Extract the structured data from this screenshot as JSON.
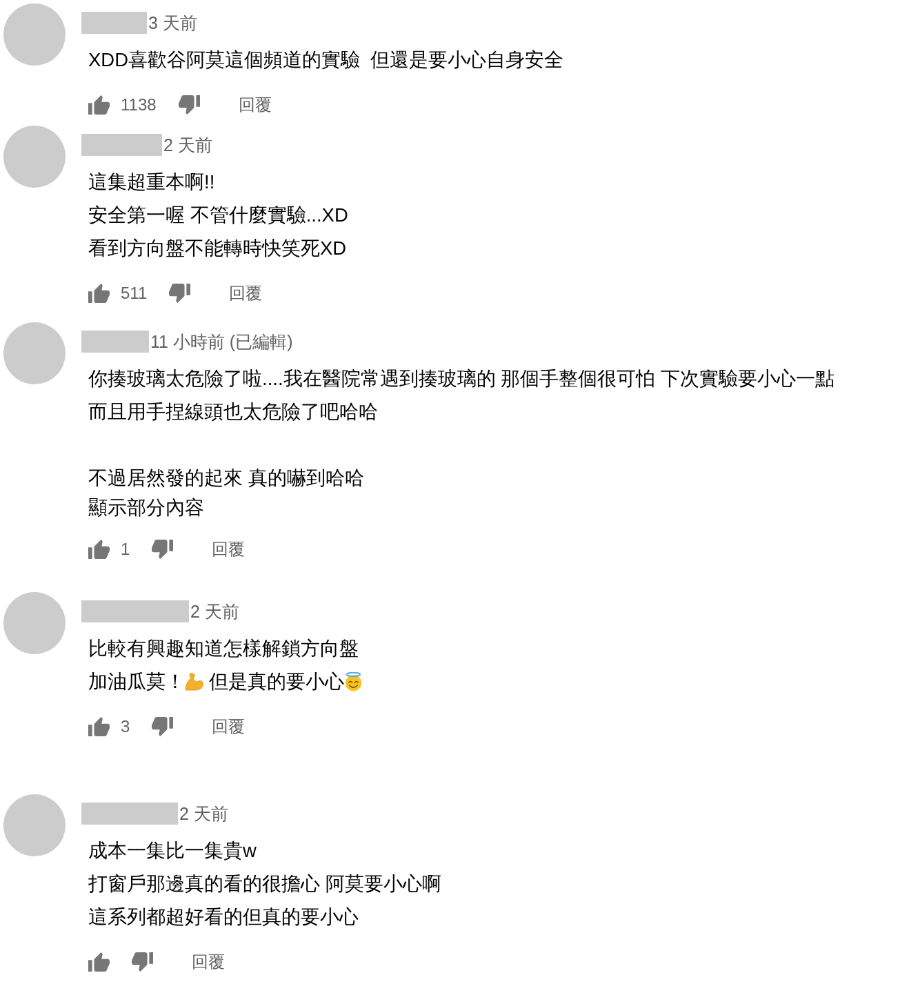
{
  "comments": [
    {
      "time": "3 天前",
      "paragraphs": [
        [
          [
            {
              "kind": "text",
              "text": "XDD喜歡谷阿莫這個頻道的實驗  但還是要小心自身安全"
            }
          ]
        ]
      ],
      "like_count": "1138",
      "reply": "回覆"
    },
    {
      "time": "2 天前",
      "paragraphs": [
        [
          [
            {
              "kind": "text",
              "text": "這集超重本啊!!"
            }
          ],
          [
            {
              "kind": "text",
              "text": "安全第一喔 不管什麼實驗...XD"
            }
          ],
          [
            {
              "kind": "text",
              "text": "看到方向盤不能轉時快笑死XD"
            }
          ]
        ]
      ],
      "like_count": "511",
      "reply": "回覆"
    },
    {
      "time": "11 小時前 (已編輯)",
      "paragraphs": [
        [
          [
            {
              "kind": "text",
              "text": "你揍玻璃太危險了啦....我在醫院常遇到揍玻璃的 那個手整個很可怕 下次實驗要小心一點"
            }
          ],
          [
            {
              "kind": "text",
              "text": "而且用手捏線頭也太危險了吧哈哈"
            }
          ]
        ],
        [
          [
            {
              "kind": "text",
              "text": "不過居然發的起來 真的嚇到哈哈"
            }
          ]
        ]
      ],
      "show_less": "顯示部分內容",
      "like_count": "1",
      "reply": "回覆"
    },
    {
      "time": "2 天前",
      "paragraphs": [
        [
          [
            {
              "kind": "text",
              "text": "比較有興趣知道怎樣解鎖方向盤"
            }
          ],
          [
            {
              "kind": "text",
              "text": "加油瓜莫！"
            },
            {
              "kind": "flexed-arm-emoji"
            },
            {
              "kind": "text",
              "text": " 但是真的要小心"
            },
            {
              "kind": "halo-smile-emoji"
            }
          ]
        ]
      ],
      "like_count": "3",
      "reply": "回覆"
    },
    {
      "time": "2 天前",
      "paragraphs": [
        [
          [
            {
              "kind": "text",
              "text": "成本一集比一集貴w"
            }
          ],
          [
            {
              "kind": "text",
              "text": "打窗戶那邊真的看的很擔心 阿莫要小心啊"
            }
          ],
          [
            {
              "kind": "text",
              "text": "這系列都超好看的但真的要小心"
            }
          ]
        ]
      ],
      "reply": "回覆"
    }
  ]
}
